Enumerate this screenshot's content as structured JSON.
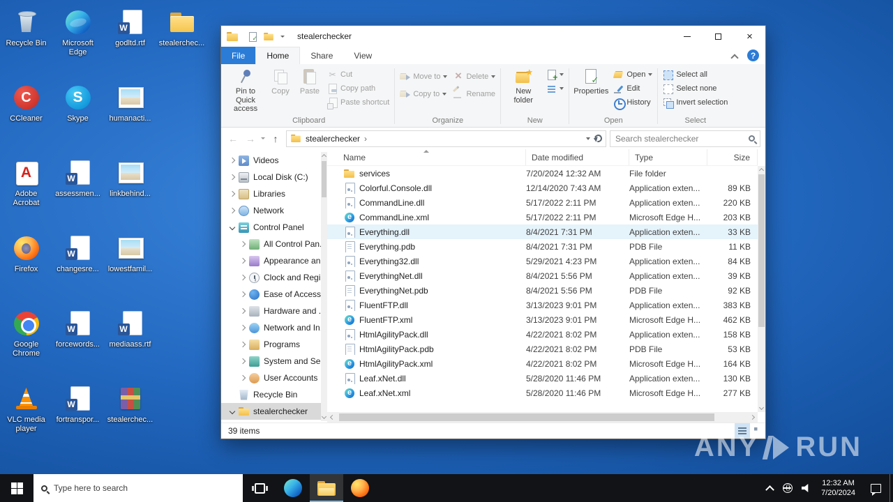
{
  "desktop": {
    "columns": [
      {
        "items": [
          {
            "label": "Recycle Bin",
            "icon": "recyclebin"
          },
          {
            "label": "CCleaner",
            "icon": "ccleaner"
          },
          {
            "label": "Adobe Acrobat",
            "icon": "acrobat"
          },
          {
            "label": "Firefox",
            "icon": "firefox"
          },
          {
            "label": "Google Chrome",
            "icon": "chrome"
          },
          {
            "label": "VLC media player",
            "icon": "vlc"
          }
        ]
      },
      {
        "items": [
          {
            "label": "Microsoft Edge",
            "icon": "edge"
          },
          {
            "label": "Skype",
            "icon": "skype"
          },
          {
            "label": "assessmen...",
            "icon": "word"
          },
          {
            "label": "changesre...",
            "icon": "word"
          },
          {
            "label": "forcewords...",
            "icon": "word"
          },
          {
            "label": "fortranspor...",
            "icon": "word"
          }
        ]
      },
      {
        "items": [
          {
            "label": "godltd.rtf",
            "icon": "word"
          },
          {
            "label": "humanacti...",
            "icon": "image"
          },
          {
            "label": "linkbehind...",
            "icon": "image"
          },
          {
            "label": "lowestfamil...",
            "icon": "image"
          },
          {
            "label": "mediaass.rtf",
            "icon": "word"
          },
          {
            "label": "stealerchec...",
            "icon": "winrar"
          }
        ]
      },
      {
        "items": [
          {
            "label": "stealerchec...",
            "icon": "folder"
          }
        ]
      }
    ]
  },
  "window": {
    "title": "stealerchecker",
    "tabs": [
      {
        "label": "File",
        "cls": "file"
      },
      {
        "label": "Home",
        "cls": "active"
      },
      {
        "label": "Share",
        "cls": ""
      },
      {
        "label": "View",
        "cls": ""
      }
    ],
    "ribbon": {
      "pin": "Pin to Quick access",
      "copy": "Copy",
      "paste": "Paste",
      "cut": "Cut",
      "copy_path": "Copy path",
      "paste_shortcut": "Paste shortcut",
      "move_to": "Move to",
      "copy_to": "Copy to",
      "delete": "Delete",
      "rename": "Rename",
      "new_folder": "New folder",
      "properties": "Properties",
      "open": "Open",
      "edit": "Edit",
      "history": "History",
      "select_all": "Select all",
      "select_none": "Select none",
      "invert_selection": "Invert selection",
      "groups": [
        "Clipboard",
        "Organize",
        "New",
        "Open",
        "Select"
      ]
    },
    "address": {
      "path": "stealerchecker",
      "search_placeholder": "Search stealerchecker"
    },
    "nav": {
      "items": [
        {
          "label": "Videos",
          "cls": "lvl0",
          "chev": "c-r",
          "icon": "videos"
        },
        {
          "label": "Local Disk (C:)",
          "cls": "lvl0",
          "chev": "c-r",
          "icon": "local-disk"
        },
        {
          "label": "Libraries",
          "cls": "lvl0",
          "chev": "c-r",
          "icon": "libraries"
        },
        {
          "label": "Network",
          "cls": "lvl0",
          "chev": "c-r",
          "icon": "network"
        },
        {
          "label": "Control Panel",
          "cls": "lvl0",
          "chev": "c-d",
          "icon": "control-panel"
        },
        {
          "label": "All Control Pan...",
          "cls": "lvl1",
          "chev": "c-r",
          "icon": "all-control-panel"
        },
        {
          "label": "Appearance an...",
          "cls": "lvl1",
          "chev": "c-r",
          "icon": "appearance"
        },
        {
          "label": "Clock and Regi...",
          "cls": "lvl1",
          "chev": "c-r",
          "icon": "clock-region"
        },
        {
          "label": "Ease of Access",
          "cls": "lvl1",
          "chev": "c-r",
          "icon": "ease-of-access"
        },
        {
          "label": "Hardware and ...",
          "cls": "lvl1",
          "chev": "c-r",
          "icon": "hardware"
        },
        {
          "label": "Network and In...",
          "cls": "lvl1",
          "chev": "c-r",
          "icon": "network-internet"
        },
        {
          "label": "Programs",
          "cls": "lvl1",
          "chev": "c-r",
          "icon": "programs"
        },
        {
          "label": "System and Se...",
          "cls": "lvl1",
          "chev": "c-r",
          "icon": "system-security"
        },
        {
          "label": "User Accounts",
          "cls": "lvl1",
          "chev": "c-r",
          "icon": "user-accounts"
        },
        {
          "label": "Recycle Bin",
          "cls": "lvl0",
          "chev": "",
          "icon": "recycle-bin"
        },
        {
          "label": "stealerchecker",
          "cls": "lvl0 sel",
          "chev": "c-d",
          "icon": "folder"
        }
      ]
    },
    "files": {
      "columns": [
        "Name",
        "Date modified",
        "Type",
        "Size"
      ],
      "rows": [
        {
          "name": "services",
          "date": "7/20/2024 12:32 AM",
          "type": "File folder",
          "size": "",
          "icon": "folder",
          "state": ""
        },
        {
          "name": "Colorful.Console.dll",
          "date": "12/14/2020 7:43 AM",
          "type": "Application exten...",
          "size": "89 KB",
          "icon": "dll",
          "state": ""
        },
        {
          "name": "CommandLine.dll",
          "date": "5/17/2022 2:11 PM",
          "type": "Application exten...",
          "size": "220 KB",
          "icon": "dll",
          "state": ""
        },
        {
          "name": "CommandLine.xml",
          "date": "5/17/2022 2:11 PM",
          "type": "Microsoft Edge H...",
          "size": "203 KB",
          "icon": "edgehtml",
          "state": ""
        },
        {
          "name": "Everything.dll",
          "date": "8/4/2021 7:31 PM",
          "type": "Application exten...",
          "size": "33 KB",
          "icon": "dll",
          "state": "hov"
        },
        {
          "name": "Everything.pdb",
          "date": "8/4/2021 7:31 PM",
          "type": "PDB File",
          "size": "11 KB",
          "icon": "file",
          "state": ""
        },
        {
          "name": "Everything32.dll",
          "date": "5/29/2021 4:23 PM",
          "type": "Application exten...",
          "size": "84 KB",
          "icon": "dll",
          "state": ""
        },
        {
          "name": "EverythingNet.dll",
          "date": "8/4/2021 5:56 PM",
          "type": "Application exten...",
          "size": "39 KB",
          "icon": "dll",
          "state": ""
        },
        {
          "name": "EverythingNet.pdb",
          "date": "8/4/2021 5:56 PM",
          "type": "PDB File",
          "size": "92 KB",
          "icon": "file",
          "state": ""
        },
        {
          "name": "FluentFTP.dll",
          "date": "3/13/2023 9:01 PM",
          "type": "Application exten...",
          "size": "383 KB",
          "icon": "dll",
          "state": ""
        },
        {
          "name": "FluentFTP.xml",
          "date": "3/13/2023 9:01 PM",
          "type": "Microsoft Edge H...",
          "size": "462 KB",
          "icon": "edgehtml",
          "state": ""
        },
        {
          "name": "HtmlAgilityPack.dll",
          "date": "4/22/2021 8:02 PM",
          "type": "Application exten...",
          "size": "158 KB",
          "icon": "dll",
          "state": ""
        },
        {
          "name": "HtmlAgilityPack.pdb",
          "date": "4/22/2021 8:02 PM",
          "type": "PDB File",
          "size": "53 KB",
          "icon": "file",
          "state": ""
        },
        {
          "name": "HtmlAgilityPack.xml",
          "date": "4/22/2021 8:02 PM",
          "type": "Microsoft Edge H...",
          "size": "164 KB",
          "icon": "edgehtml",
          "state": ""
        },
        {
          "name": "Leaf.xNet.dll",
          "date": "5/28/2020 11:46 PM",
          "type": "Application exten...",
          "size": "130 KB",
          "icon": "dll",
          "state": ""
        },
        {
          "name": "Leaf.xNet.xml",
          "date": "5/28/2020 11:46 PM",
          "type": "Microsoft Edge H...",
          "size": "277 KB",
          "icon": "edgehtml",
          "state": ""
        }
      ]
    },
    "status": {
      "items_count": "39 items"
    }
  },
  "taskbar": {
    "search_placeholder": "Type here to search",
    "time": "12:32 AM",
    "date": "7/20/2024"
  },
  "watermark": {
    "left": "ANY",
    "right": "RUN"
  }
}
